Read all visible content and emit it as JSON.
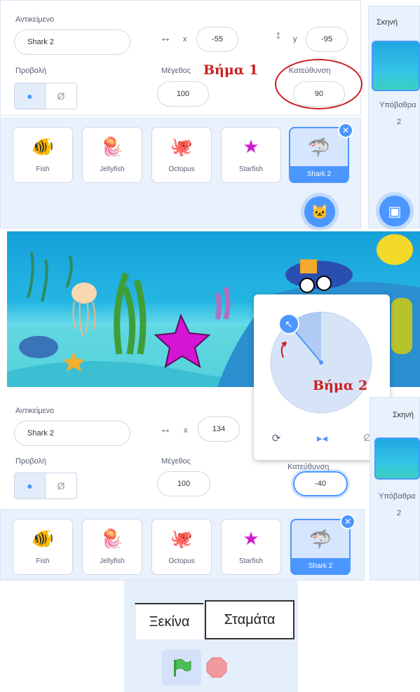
{
  "top": {
    "sprite_label": "Αντικείμενο",
    "sprite_name": "Shark 2",
    "x_label": "x",
    "x_val": "-55",
    "y_label": "y",
    "y_val": "-95",
    "show_label": "Προβολή",
    "size_label": "Μέγεθος",
    "size_val": "100",
    "dir_label": "Κατεύθυνση",
    "dir_val": "90",
    "annotation": "Βήμα 1"
  },
  "stage_col_top": {
    "title": "Σκηνή",
    "backdrops_label": "Υπόβαθρα",
    "backdrops_count": "2"
  },
  "sprites": [
    {
      "name": "Fish",
      "icon": "fish-icon"
    },
    {
      "name": "Jellyfish",
      "icon": "jellyfish-icon"
    },
    {
      "name": "Octopus",
      "icon": "octopus-icon"
    },
    {
      "name": "Starfish",
      "icon": "starfish-icon"
    },
    {
      "name": "Shark 2",
      "icon": "shark-icon"
    }
  ],
  "stage_annotation": "Βήμα 2",
  "bottom": {
    "sprite_label": "Αντικείμενο",
    "sprite_name": "Shark 2",
    "x_label": "x",
    "x_val": "134",
    "show_label": "Προβολή",
    "size_label": "Μέγεθος",
    "size_val": "100",
    "dir_label": "Κατεύθυνση",
    "dir_val": "-40"
  },
  "stage_col_bottom": {
    "title": "Σκηνή",
    "backdrops_label": "Υπόβαθρα",
    "backdrops_count": "2"
  },
  "controls": {
    "start_label": "Ξεκίνα",
    "stop_label": "Σταμάτα"
  },
  "colors": {
    "accent": "#4c97ff",
    "annotation": "#cc1f1f",
    "panel": "#e9f1fc"
  }
}
